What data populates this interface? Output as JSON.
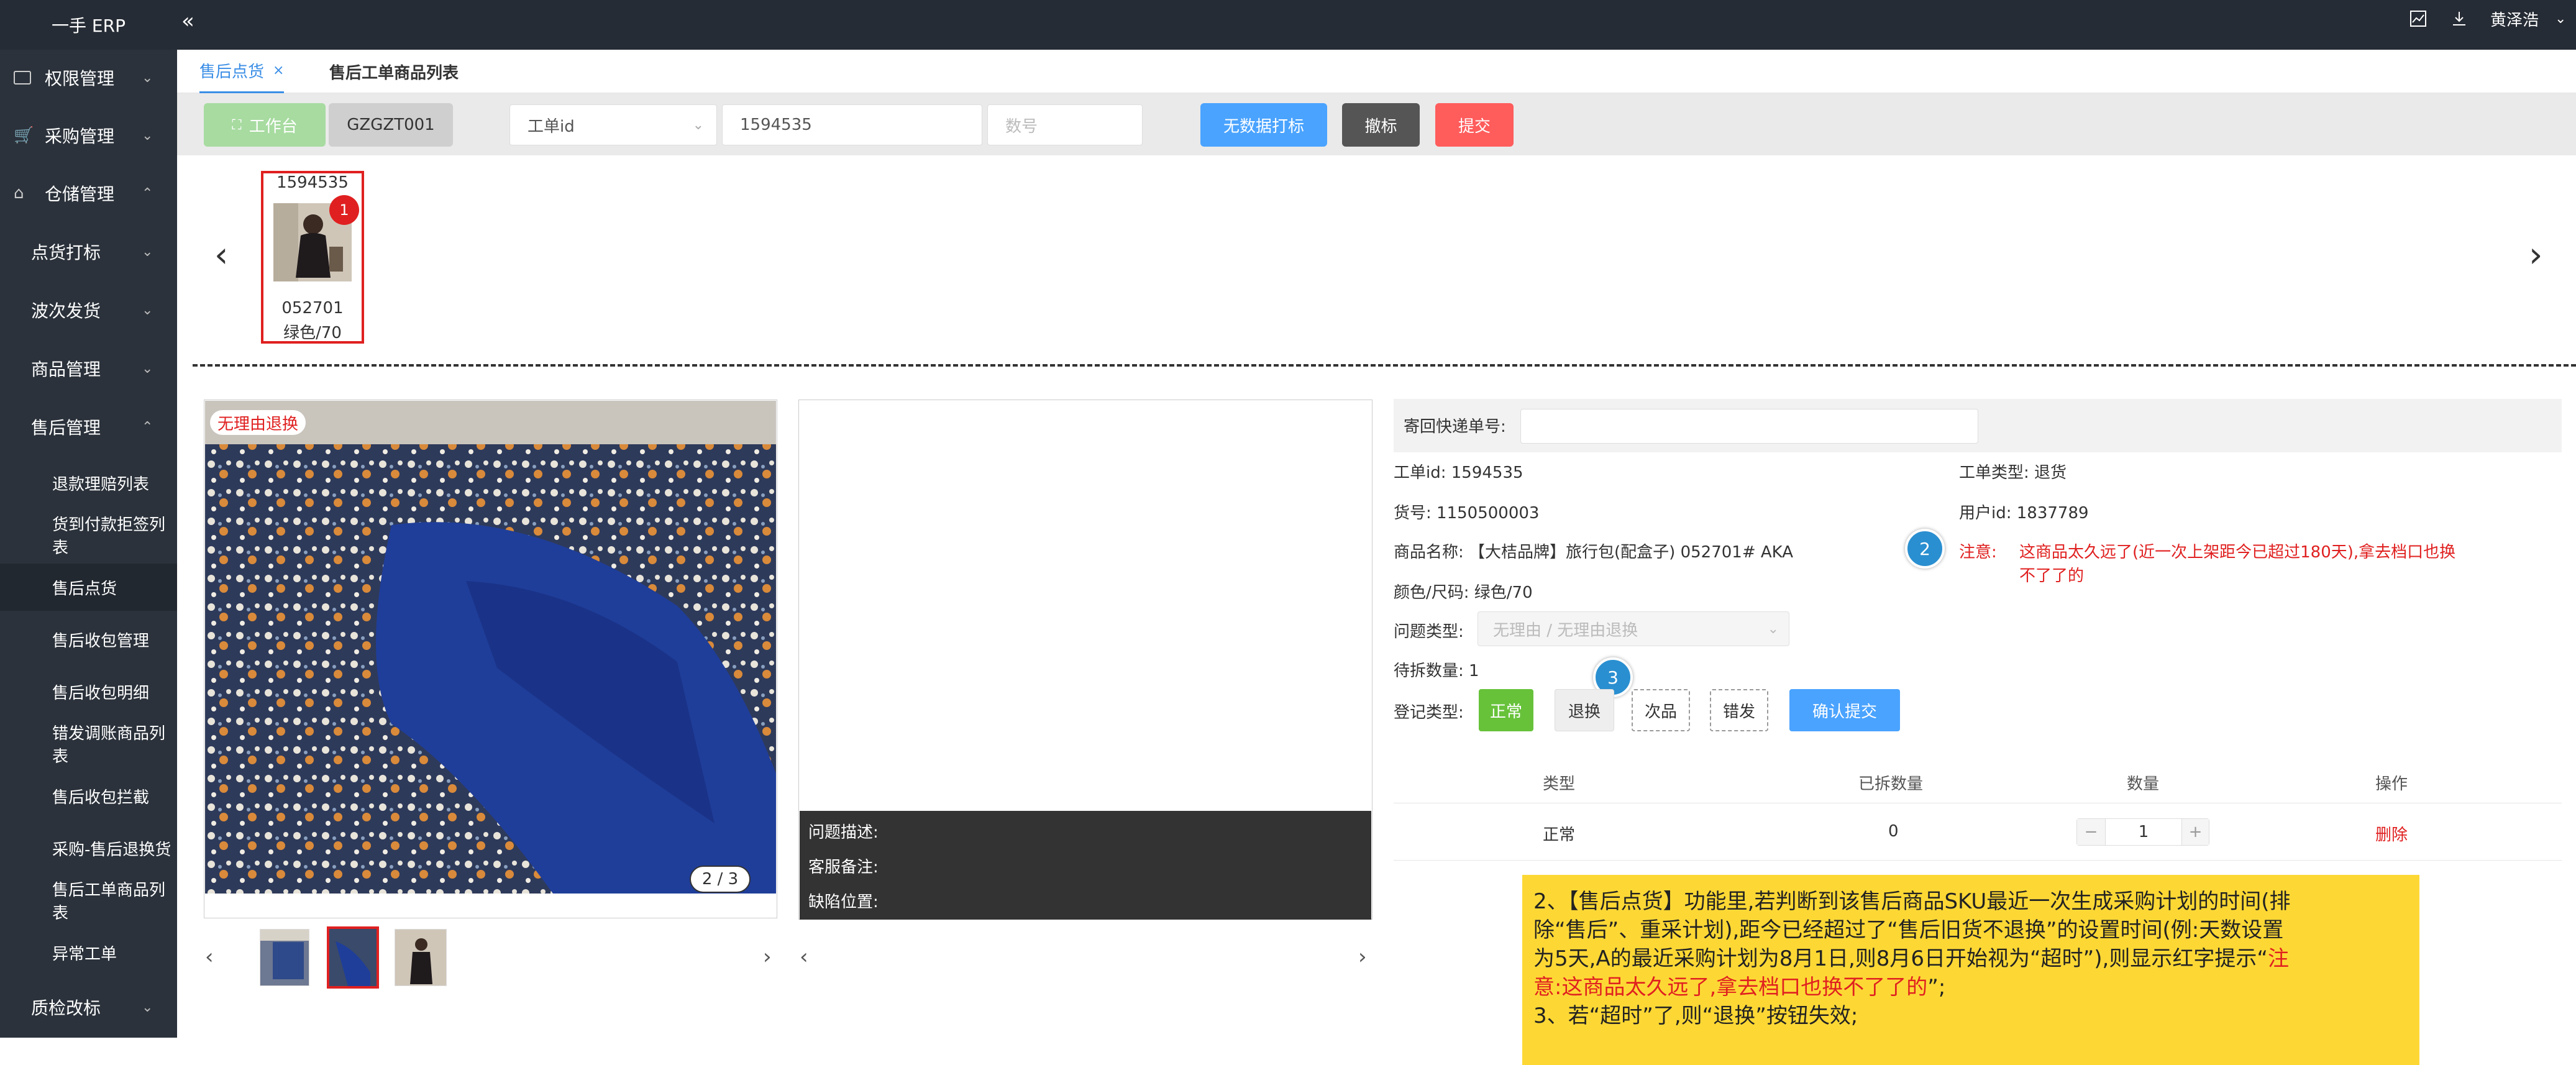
{
  "app": {
    "title": "一手 ERP",
    "user": "黄泽浩"
  },
  "sidebar": {
    "items": [
      {
        "label": "权限管理"
      },
      {
        "label": "采购管理"
      },
      {
        "label": "仓储管理"
      },
      {
        "label": "点货打标"
      },
      {
        "label": "波次发货"
      },
      {
        "label": "商品管理"
      },
      {
        "label": "售后管理"
      },
      {
        "label": "退款理赔列表"
      },
      {
        "label": "货到付款拒签列表"
      },
      {
        "label": "售后点货"
      },
      {
        "label": "售后收包管理"
      },
      {
        "label": "售后收包明细"
      },
      {
        "label": "错发调账商品列表"
      },
      {
        "label": "售后收包拦截"
      },
      {
        "label": "采购-售后退换货"
      },
      {
        "label": "售后工单商品列表"
      },
      {
        "label": "异常工单"
      },
      {
        "label": "质检改标"
      }
    ]
  },
  "tabs": [
    {
      "label": "售后点货",
      "close": "×"
    },
    {
      "label": "售后工单商品列表"
    }
  ],
  "toolbar": {
    "workbench": "工作台",
    "code": "GZGZT001",
    "select_value": "工单id",
    "id_value": "1594535",
    "count_placeholder": "数号",
    "btn_nodata": "无数据打标",
    "btn_undo": "撤标",
    "btn_submit": "提交"
  },
  "gallery": {
    "card_id": "1594535",
    "badge": "1",
    "sku": "052701",
    "spec": "绿色/70"
  },
  "photo": {
    "tag": "无理由退换",
    "counter": "2 / 3",
    "prev": "‹",
    "next": "›"
  },
  "caption": {
    "problem": "问题描述:",
    "remark": "客服备注:",
    "defect": "缺陷位置:"
  },
  "form": {
    "return_express_label": "寄回快递单号:",
    "order_id": "工单id: 1594535",
    "order_type": "工单类型: 退货",
    "goods_no": "货号: 1150500003",
    "user_id": "用户id: 1837789",
    "goods_name": "商品名称: 【大桔品牌】旅行包(配盒子) 052701# AKA",
    "note_badge": "2",
    "note_prefix": "注意:",
    "note_line1": "这商品太久远了(近一次上架距今已超过180天),拿去档口也换",
    "note_line2": "不了了的",
    "color_size": "颜色/尺码: 绿色/70",
    "issue_type_label": "问题类型:",
    "issue_type_value": "无理由 / 无理由退换",
    "pending_qty": "待拆数量: 1",
    "badge3": "3",
    "register_label": "登记类型:",
    "btn_normal": "正常",
    "btn_return": "退换",
    "btn_defect": "次品",
    "btn_wrong": "错发",
    "btn_confirm": "确认提交"
  },
  "table": {
    "headers": [
      "类型",
      "已拆数量",
      "数量",
      "操作"
    ],
    "rows": [
      {
        "type": "正常",
        "split": "0",
        "qty": "1",
        "op": "删除"
      }
    ],
    "minus": "−",
    "plus": "+"
  },
  "note_box": {
    "p1a": "2、【售后点货】功能里,若判断到该售后商品SKU最近一次生成采购计划的时间(排",
    "p1b": "除“售后”、重采计划),距今已经超过了“售后旧货不退换”的设置时间(例:天数设置",
    "p1c": "为5天,A的最近采购计划为8月1日,则8月6日开始视为“超时”),则显示红字提示“",
    "p1d_red_a": "注",
    "p1e_red": "意:这商品太久远了,拿去档口也换不了了的",
    "p1f": "”;",
    "p2": "3、若“超时”了,则“退换”按钮失效;"
  },
  "colors": {
    "accent": "#4aa3ff",
    "danger": "#ff5c5c",
    "success": "#67c23a",
    "note": "#fdd835"
  }
}
